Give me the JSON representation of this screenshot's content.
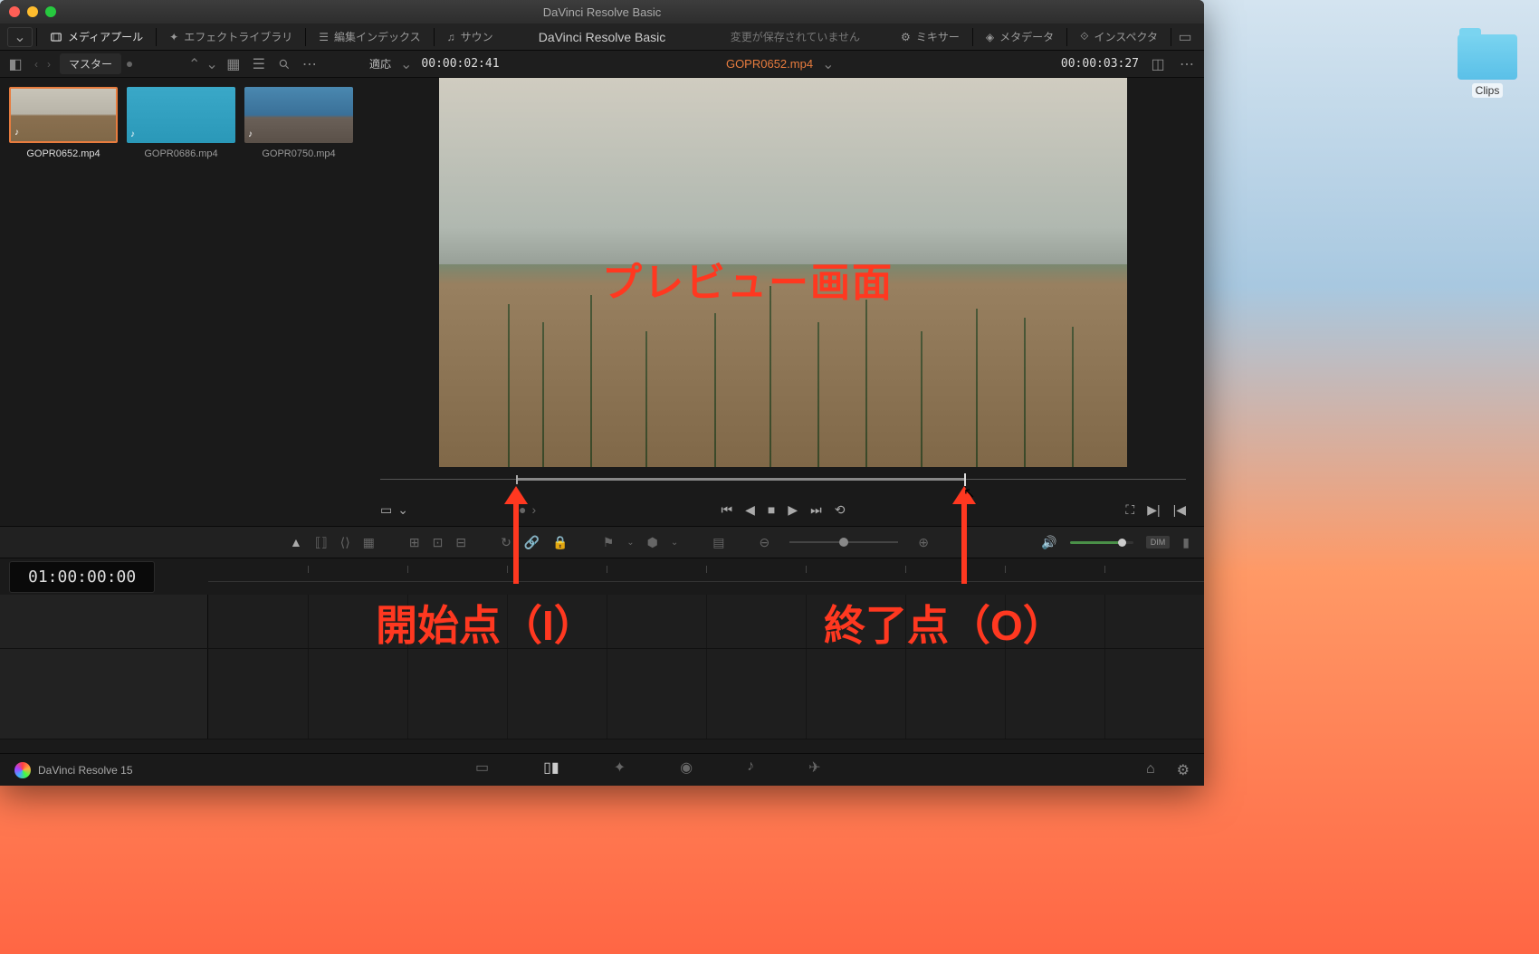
{
  "window": {
    "title": "DaVinci Resolve Basic",
    "center_title": "DaVinci Resolve Basic",
    "unsaved_label": "変更が保存されていません"
  },
  "top_menu": {
    "media_pool": "メディアプール",
    "effect_library": "エフェクトライブラリ",
    "edit_index": "編集インデックス",
    "sound": "サウン",
    "mixer": "ミキサー",
    "metadata": "メタデータ",
    "inspector": "インスペクタ"
  },
  "toolbar": {
    "master": "マスター",
    "fit": "適応",
    "src_timecode": "00:00:02:41",
    "clip_name": "GOPR0652.mp4",
    "rec_timecode": "00:00:03:27"
  },
  "clips": [
    {
      "name": "GOPR0652.mp4",
      "selected": true
    },
    {
      "name": "GOPR0686.mp4",
      "selected": false
    },
    {
      "name": "GOPR0750.mp4",
      "selected": false
    }
  ],
  "annotations": {
    "preview": "プレビュー画面",
    "in_point": "開始点（I）",
    "out_point": "終了点（O）"
  },
  "timeline": {
    "timecode": "01:00:00:00"
  },
  "bottom_bar": {
    "app_version": "DaVinci Resolve 15"
  },
  "desktop": {
    "folder_name": "Clips"
  },
  "vol": {
    "dim": "DIM"
  }
}
